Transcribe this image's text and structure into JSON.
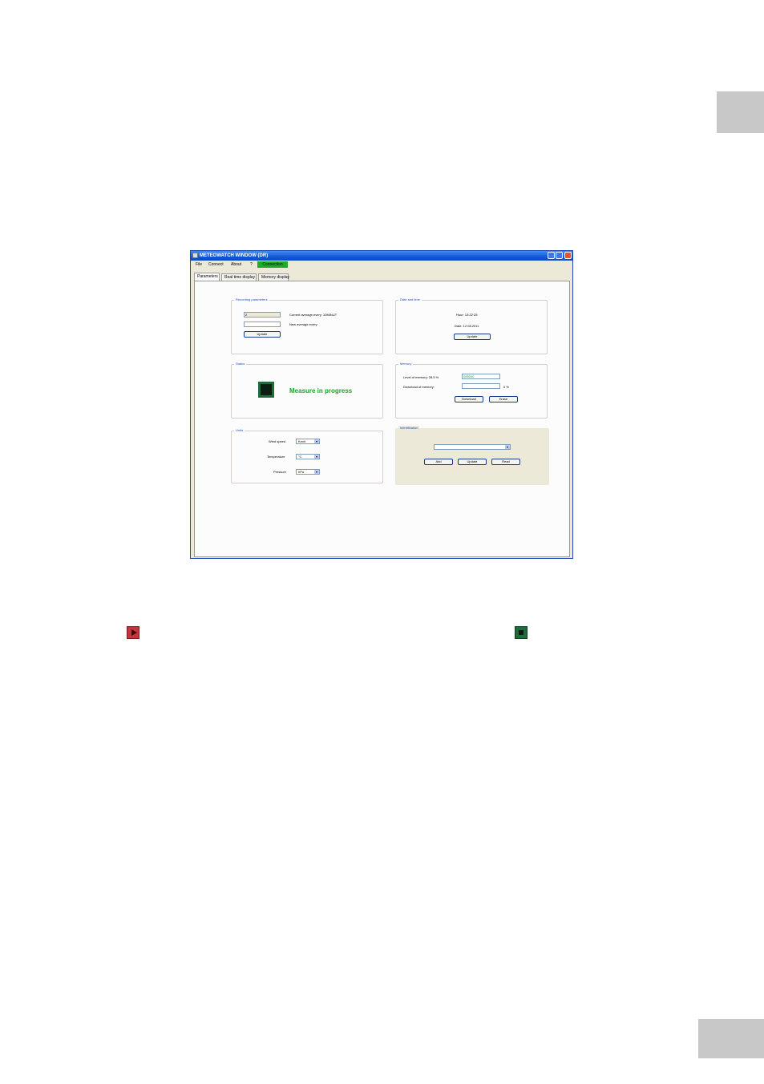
{
  "window": {
    "title": "METEOWATCH WINDOW (DR)",
    "menu": {
      "file": "File",
      "connect": "Connect",
      "about": "About",
      "extra": "?",
      "status": "Connection"
    },
    "tabs": [
      "Parameters",
      "Real time display",
      "Memory display"
    ]
  },
  "parameters_tab": {
    "average": {
      "title": "Recording parameters",
      "current_value": "2",
      "current_label": "Current average every: 10MINUT",
      "new_label": "New average every:",
      "update_button": "Update"
    },
    "datetime": {
      "title": "Date and time",
      "hour": "Hour: 13:22:25",
      "date": "Date: 12.08.2011",
      "update_button": "Update"
    },
    "status": {
      "title": "Status",
      "text": "Measure in progress"
    },
    "memory": {
      "title": "Memory",
      "level_label": "Level of memory: 28.5 %",
      "level_value": "000000",
      "download_label": "Download of memory:",
      "download_unit": "0 %",
      "download_button": "Download",
      "erase_button": "Erase"
    },
    "units": {
      "title": "Units",
      "wind_speed_label": "Wind speed",
      "wind_speed_value": "Km/h",
      "temperature_label": "Temperature",
      "temperature_value": "°C",
      "pressure_label": "Pressure",
      "pressure_value": "hPa"
    },
    "identification": {
      "title": "Identification",
      "combo_value": "",
      "add_button": "Add",
      "update_button": "Update",
      "read_button": "Read"
    }
  },
  "colors": {
    "start_icon": "#c9343c",
    "stop_icon": "#1f6b3a",
    "status_text": "#1ea22a"
  }
}
